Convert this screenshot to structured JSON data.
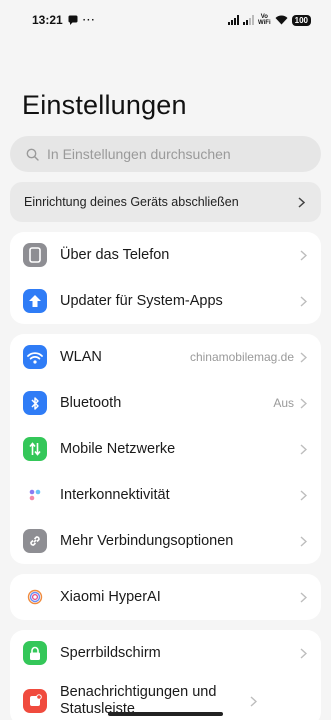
{
  "status_bar": {
    "time": "13:21",
    "more": "···",
    "volte_line1": "Vo",
    "volte_line2": "WiFi",
    "battery": "100"
  },
  "page_title": "Einstellungen",
  "search": {
    "placeholder": "In Einstellungen durchsuchen"
  },
  "banner": {
    "label": "Einrichtung deines Geräts abschließen"
  },
  "groups": [
    {
      "items": [
        {
          "label": "Über das Telefon",
          "icon": "phone-icon",
          "color": "#8e8e93"
        },
        {
          "label": "Updater für System-Apps",
          "icon": "arrow-up-icon",
          "color": "#2f7cf6"
        }
      ]
    },
    {
      "items": [
        {
          "label": "WLAN",
          "value": "chinamobilemag.de",
          "icon": "wifi-icon",
          "color": "#2f7cf6"
        },
        {
          "label": "Bluetooth",
          "value": "Aus",
          "icon": "bluetooth-icon",
          "color": "#2f7cf6"
        },
        {
          "label": "Mobile Netzwerke",
          "icon": "mobile-data-icon",
          "color": "#34c759"
        },
        {
          "label": "Interkonnektivität",
          "icon": "interconnect-icon",
          "color": "#ffffff"
        },
        {
          "label": "Mehr Verbindungsoptionen",
          "icon": "link-icon",
          "color": "#8e8e93"
        }
      ]
    },
    {
      "items": [
        {
          "label": "Xiaomi HyperAI",
          "icon": "hyperai-icon",
          "color": "#ffffff"
        }
      ]
    },
    {
      "items": [
        {
          "label": "Sperrbildschirm",
          "icon": "lock-icon",
          "color": "#34c759"
        },
        {
          "label": "Benachrichtigungen und Statusleiste",
          "icon": "notification-icon",
          "color": "#f04b3e"
        }
      ]
    }
  ]
}
